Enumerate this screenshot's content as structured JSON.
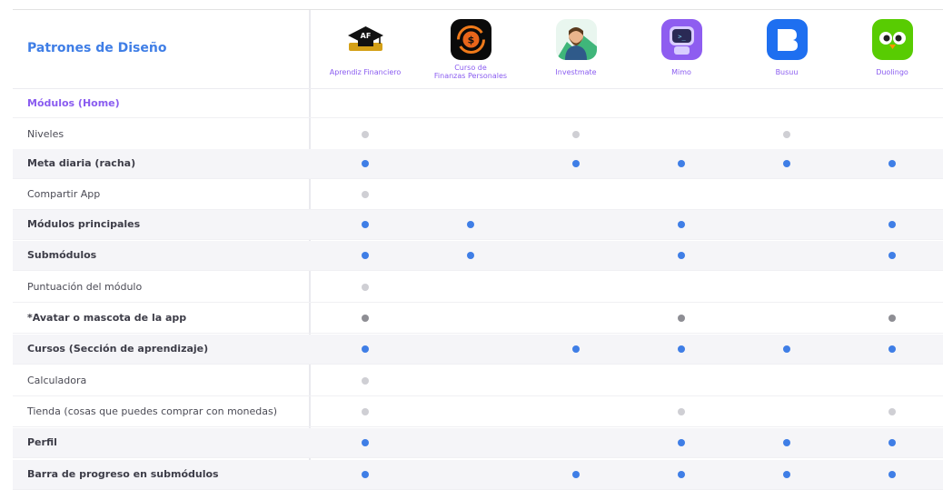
{
  "page_title": "Patrones de Diseño",
  "apps": [
    {
      "name_lines": [
        "Aprendiz Financiero"
      ],
      "logo_text": "AF",
      "icon": "graduation-cap-icon"
    },
    {
      "name_lines": [
        "Curso de",
        "Finanzas Personales"
      ],
      "logo_text": "$",
      "icon": "coin-cycle-icon"
    },
    {
      "name_lines": [
        "Investmate"
      ],
      "icon": "bearded-man-mascot-icon"
    },
    {
      "name_lines": [
        "Mimo"
      ],
      "icon": "robot-mascot-icon"
    },
    {
      "name_lines": [
        "Busuu"
      ],
      "icon": "speech-bubble-icon"
    },
    {
      "name_lines": [
        "Duolingo"
      ],
      "icon": "owl-mascot-icon"
    }
  ],
  "section_label": "Módulos (Home)",
  "colors": {
    "blue": "#3f7ee6",
    "lightgray": "#cfcfd4",
    "darkgray": "#8e8e94",
    "title": "#3f7ee6",
    "app_name": "#8a5cf0"
  },
  "rows": [
    {
      "label": "Niveles",
      "bold": false,
      "shade": false,
      "marks": [
        "lightgray",
        null,
        "lightgray",
        null,
        "lightgray",
        null
      ]
    },
    {
      "label": "Meta diaria (racha)",
      "bold": true,
      "shade": true,
      "marks": [
        "blue",
        null,
        "blue",
        "blue",
        "blue",
        "blue"
      ]
    },
    {
      "label": "Compartir App",
      "bold": false,
      "shade": false,
      "marks": [
        "lightgray",
        null,
        null,
        null,
        null,
        null
      ]
    },
    {
      "label": "Módulos principales",
      "bold": true,
      "shade": true,
      "marks": [
        "blue",
        "blue",
        null,
        "blue",
        null,
        "blue"
      ]
    },
    {
      "label": "Submódulos",
      "bold": true,
      "shade": true,
      "marks": [
        "blue",
        "blue",
        null,
        "blue",
        null,
        "blue"
      ]
    },
    {
      "label": "Puntuación del módulo",
      "bold": false,
      "shade": false,
      "marks": [
        "lightgray",
        null,
        null,
        null,
        null,
        null
      ]
    },
    {
      "label": "*Avatar o mascota de la app",
      "bold": true,
      "shade": false,
      "marks": [
        "darkgray",
        null,
        null,
        "darkgray",
        null,
        "darkgray"
      ]
    },
    {
      "label": "Cursos (Sección de aprendizaje)",
      "bold": true,
      "shade": true,
      "marks": [
        "blue",
        null,
        "blue",
        "blue",
        "blue",
        "blue"
      ]
    },
    {
      "label": "Calculadora",
      "bold": false,
      "shade": false,
      "marks": [
        "lightgray",
        null,
        null,
        null,
        null,
        null
      ]
    },
    {
      "label": "Tienda (cosas que puedes comprar con monedas)",
      "bold": false,
      "shade": false,
      "marks": [
        "lightgray",
        null,
        null,
        "lightgray",
        null,
        "lightgray"
      ]
    },
    {
      "label": "Perfil",
      "bold": true,
      "shade": true,
      "marks": [
        "blue",
        null,
        null,
        "blue",
        "blue",
        "blue"
      ]
    },
    {
      "label": "Barra de progreso en submódulos",
      "bold": true,
      "shade": true,
      "marks": [
        "blue",
        null,
        "blue",
        "blue",
        "blue",
        "blue"
      ]
    }
  ]
}
